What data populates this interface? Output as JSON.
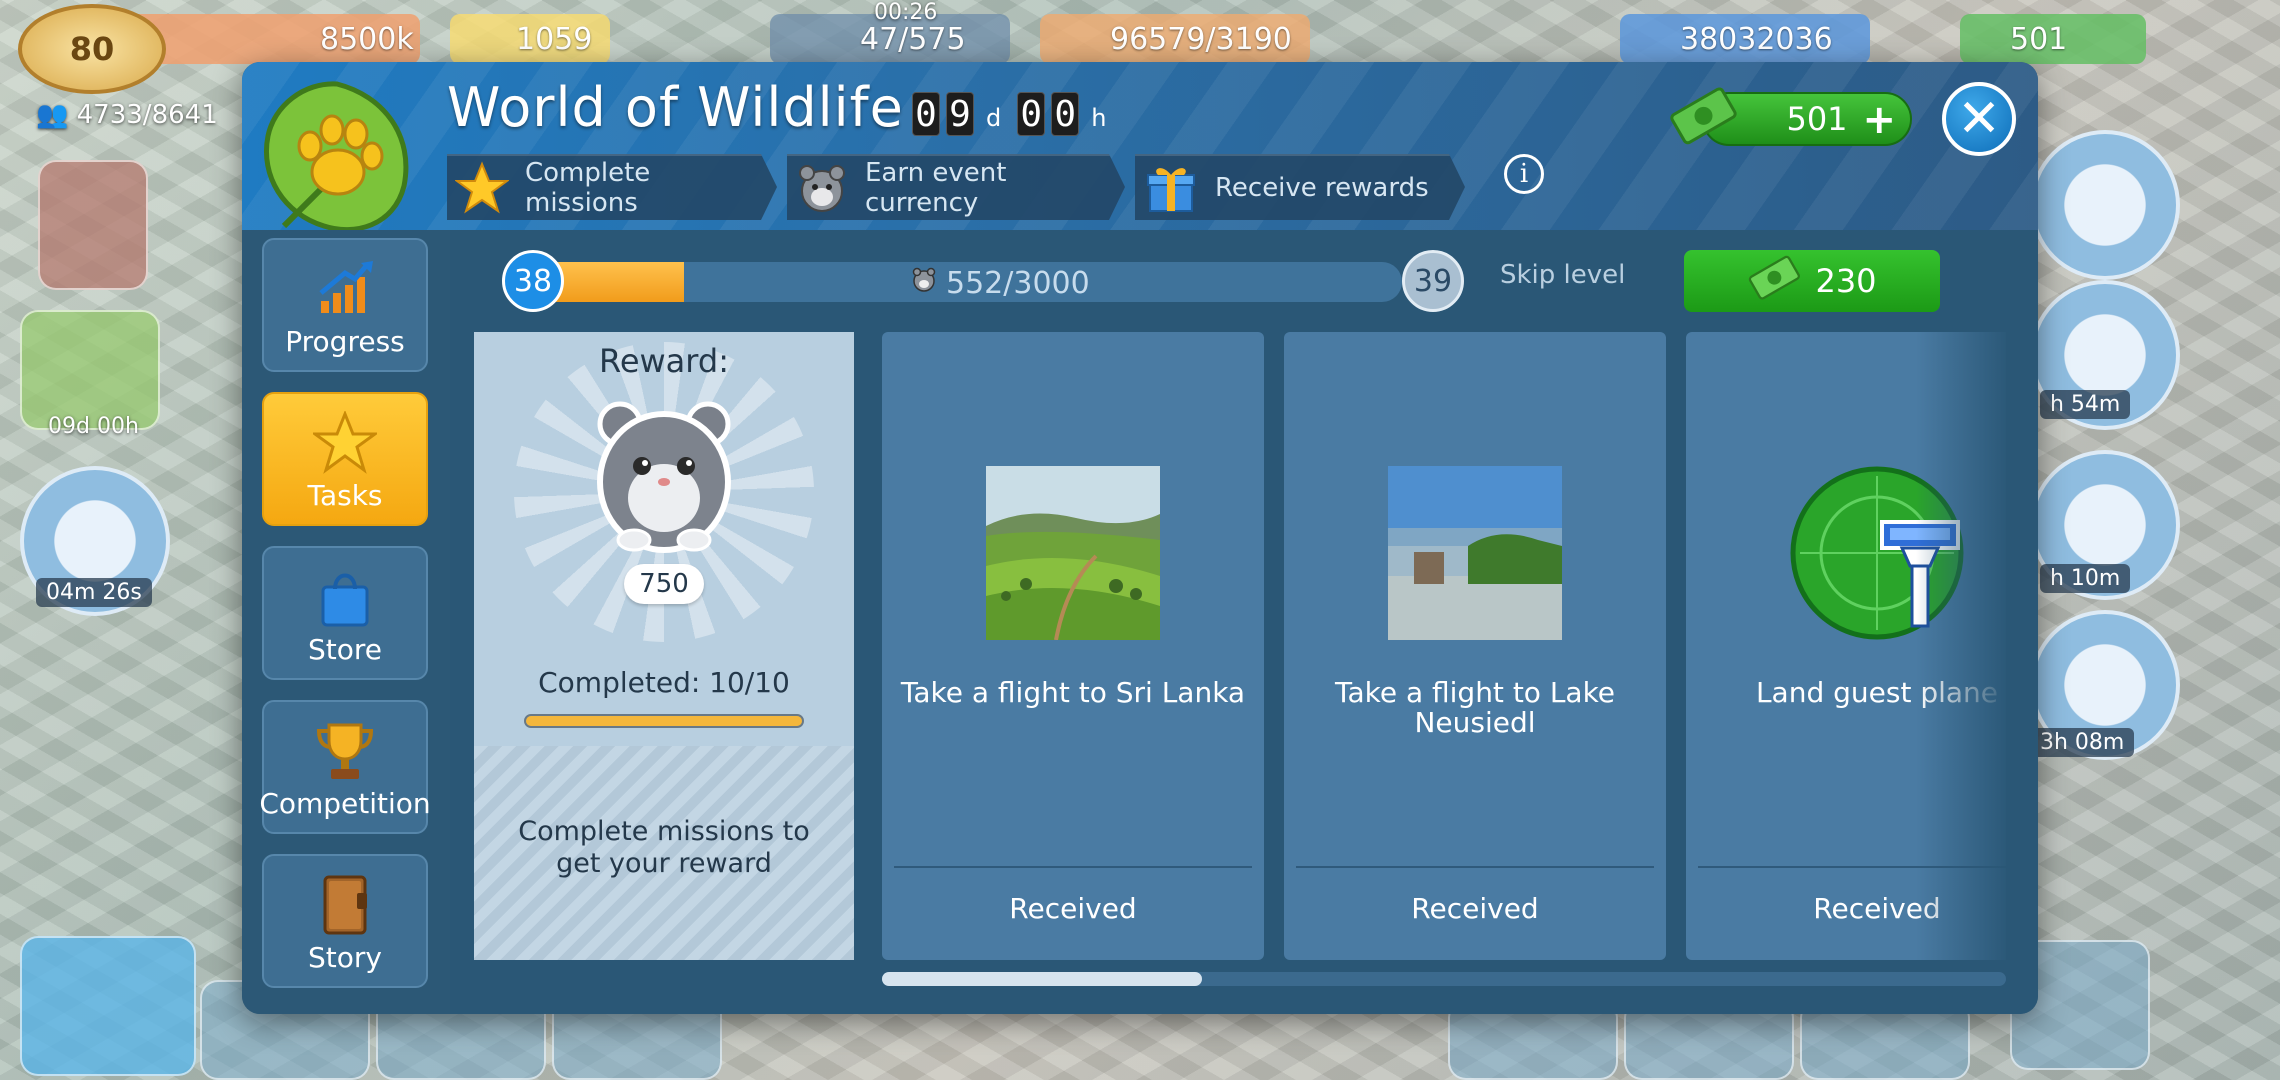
{
  "hud": {
    "player_level": "80",
    "population": "4733/8641",
    "coins": "8500k",
    "stars": "1059",
    "clock": "00:26",
    "flights": "47/575",
    "cargo": "96579/3190",
    "money": "38032036",
    "bills": "501",
    "event_timer": "09d 00h",
    "alert_timer": "04m 26s",
    "right_timer_1": "h 54m",
    "right_timer_2": "h 10m",
    "right_timer_3": "3h 08m"
  },
  "dialog": {
    "title": "World of Wildlife",
    "countdown": {
      "d1": "0",
      "d2": "9",
      "d_unit": "d",
      "h1": "0",
      "h2": "0",
      "h_unit": "h"
    },
    "steps": [
      {
        "label": "Complete missions",
        "icon": "star-icon"
      },
      {
        "label": "Earn event currency",
        "icon": "hamster-icon"
      },
      {
        "label": "Receive rewards",
        "icon": "gift-icon"
      }
    ],
    "info_label": "i",
    "currency": "501",
    "close_label": "✕"
  },
  "sidebar": {
    "items": [
      {
        "label": "Progress",
        "icon": "chart-arrow-icon",
        "active": false
      },
      {
        "label": "Tasks",
        "icon": "star-icon",
        "active": true
      },
      {
        "label": "Store",
        "icon": "shopping-bag-icon",
        "active": false
      },
      {
        "label": "Competition",
        "icon": "trophy-icon",
        "active": false
      },
      {
        "label": "Story",
        "icon": "book-icon",
        "active": false
      }
    ]
  },
  "level": {
    "current": "38",
    "next": "39",
    "progress_text": "552/3000",
    "progress_fraction": 0.184,
    "skip_label": "Skip level",
    "skip_cost": "230"
  },
  "reward": {
    "title": "Reward:",
    "amount": "750",
    "completed": "Completed: 10/10",
    "completed_fraction": 1.0,
    "hint": "Complete missions to get your reward"
  },
  "missions": [
    {
      "text": "Take a flight to Sri Lanka",
      "status": "Received",
      "image": "tea-plantation-photo"
    },
    {
      "text": "Take a flight to Lake Neusiedl",
      "status": "Received",
      "image": "lake-reeds-photo"
    },
    {
      "text": "Land guest plane",
      "status": "Received",
      "image": "control-tower-radar-icon"
    }
  ],
  "colors": {
    "accent_blue": "#1d8ee6",
    "active_tab": "#ffcb3a",
    "green_button": "#35c22e",
    "panel": "#2f5874"
  }
}
